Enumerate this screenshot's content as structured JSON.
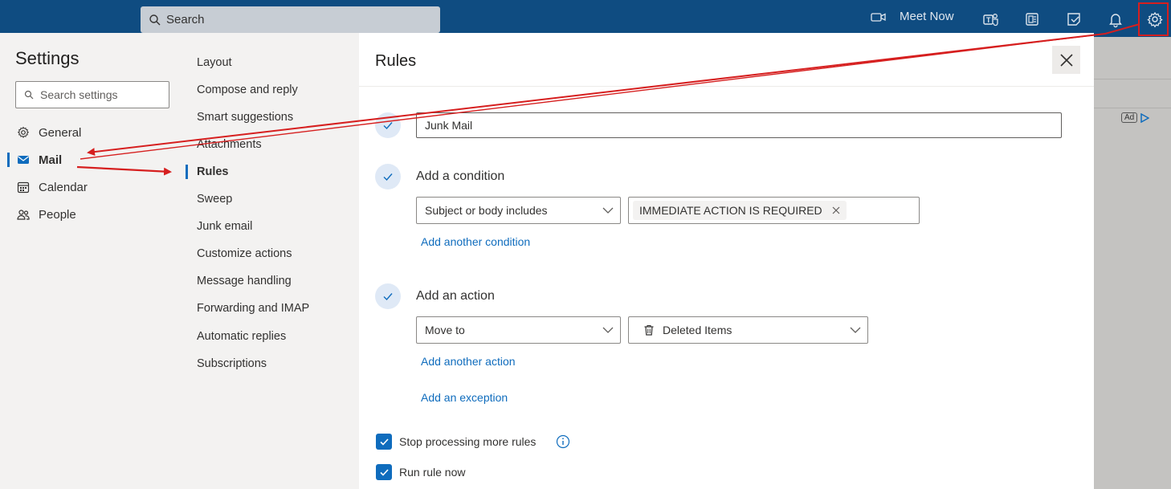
{
  "topbar": {
    "search_placeholder": "Search",
    "meet_now_label": "Meet Now",
    "icons": [
      "video-icon",
      "teams-icon",
      "office-icon",
      "todo-icon",
      "bell-icon",
      "gear-icon"
    ]
  },
  "ad": {
    "label": "Ad"
  },
  "settings": {
    "title": "Settings",
    "search_placeholder": "Search settings",
    "categories": [
      {
        "label": "General",
        "icon": "gear-icon"
      },
      {
        "label": "Mail",
        "icon": "mail-icon",
        "selected": true
      },
      {
        "label": "Calendar",
        "icon": "calendar-icon"
      },
      {
        "label": "People",
        "icon": "people-icon"
      }
    ]
  },
  "mail_nav": {
    "items": [
      {
        "label": "Layout"
      },
      {
        "label": "Compose and reply"
      },
      {
        "label": "Smart suggestions"
      },
      {
        "label": "Attachments"
      },
      {
        "label": "Rules",
        "selected": true
      },
      {
        "label": "Sweep"
      },
      {
        "label": "Junk email"
      },
      {
        "label": "Customize actions"
      },
      {
        "label": "Message handling"
      },
      {
        "label": "Forwarding and IMAP"
      },
      {
        "label": "Automatic replies"
      },
      {
        "label": "Subscriptions"
      }
    ]
  },
  "rules_panel": {
    "title": "Rules",
    "rule_name": "Junk Mail",
    "condition_heading": "Add a condition",
    "condition_select": "Subject or body includes",
    "condition_tag": "IMMEDIATE ACTION IS REQUIRED",
    "add_condition_link": "Add another condition",
    "action_heading": "Add an action",
    "action_select": "Move to",
    "action_folder": "Deleted Items",
    "add_action_link": "Add another action",
    "add_exception_link": "Add an exception",
    "stop_processing_label": "Stop processing more rules",
    "stop_processing_checked": true,
    "run_now_label": "Run rule now",
    "run_now_checked": true
  },
  "colors": {
    "topbar": "#0f4c81",
    "accent": "#0f6cbd",
    "annotation": "#d61f1f"
  }
}
